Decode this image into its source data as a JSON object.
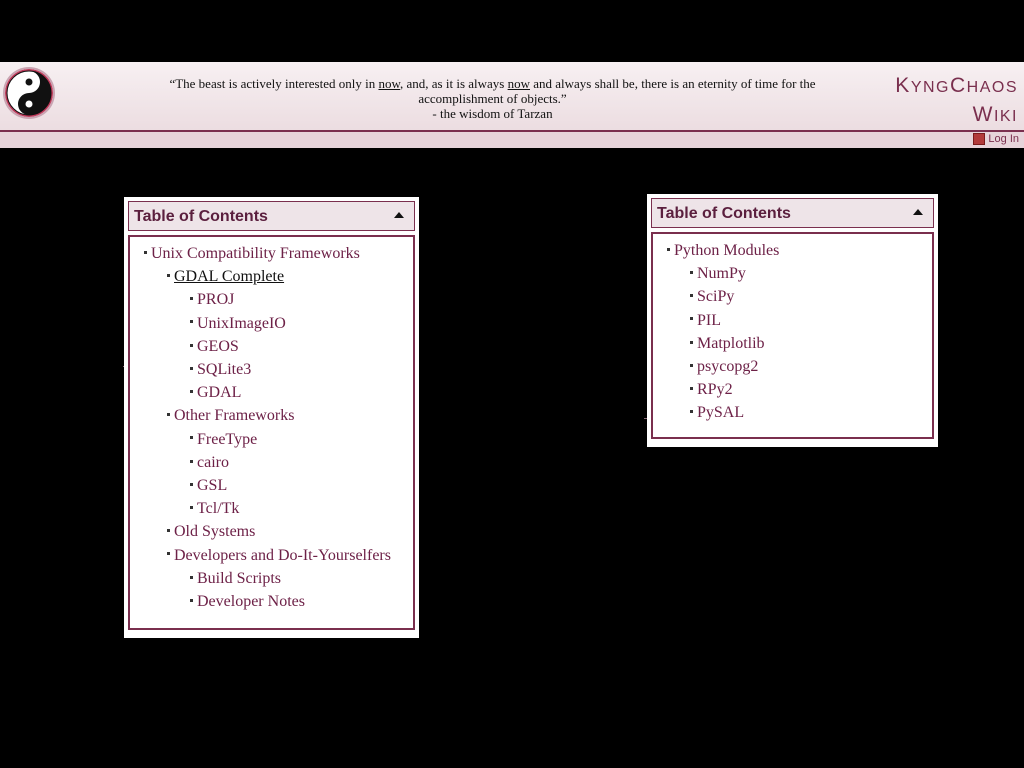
{
  "header": {
    "quote_line1_a": "“The beast is actively interested only in ",
    "quote_now1": "now",
    "quote_line1_b": ", and, as it is always ",
    "quote_now2": "now",
    "quote_line1_c": " and always shall be, there is an eternity of time for the",
    "quote_line2": "accomplishment of objects.”",
    "quote_attrib": "- the wisdom of Tarzan",
    "site_name_line1_k": "K",
    "site_name_line1_yng": "YNG",
    "site_name_line1_c": "C",
    "site_name_line1_haos": "HAOS",
    "site_name_line2_w": "W",
    "site_name_line2_iki": "IKI",
    "login_label": "Log In"
  },
  "colors": {
    "accent": "#7a2f4e",
    "link": "#6d2147",
    "header_bg": "#f3e8eb"
  },
  "toc_left": {
    "title": "Table of Contents",
    "items": [
      {
        "level": 1,
        "label": "Unix Compatibility Frameworks"
      },
      {
        "level": 2,
        "label": "GDAL Complete",
        "active": true
      },
      {
        "level": 3,
        "label": "PROJ"
      },
      {
        "level": 3,
        "label": "UnixImageIO"
      },
      {
        "level": 3,
        "label": "GEOS"
      },
      {
        "level": 3,
        "label": "SQLite3"
      },
      {
        "level": 3,
        "label": "GDAL"
      },
      {
        "level": 2,
        "label": "Other Frameworks"
      },
      {
        "level": 3,
        "label": "FreeType"
      },
      {
        "level": 3,
        "label": "cairo"
      },
      {
        "level": 3,
        "label": "GSL"
      },
      {
        "level": 3,
        "label": "Tcl/Tk"
      },
      {
        "level": 2,
        "label": "Old Systems"
      },
      {
        "level": 2,
        "label": "Developers and Do-It-Yourselfers"
      },
      {
        "level": 3,
        "label": "Build Scripts"
      },
      {
        "level": 3,
        "label": "Developer Notes"
      }
    ]
  },
  "toc_right": {
    "title": "Table of Contents",
    "items": [
      {
        "level": 1,
        "label": "Python Modules"
      },
      {
        "level": 2,
        "label": "NumPy"
      },
      {
        "level": 2,
        "label": "SciPy"
      },
      {
        "level": 2,
        "label": "PIL"
      },
      {
        "level": 2,
        "label": "Matplotlib"
      },
      {
        "level": 2,
        "label": "psycopg2"
      },
      {
        "level": 2,
        "label": "RPy2"
      },
      {
        "level": 2,
        "label": "PySAL"
      }
    ]
  }
}
